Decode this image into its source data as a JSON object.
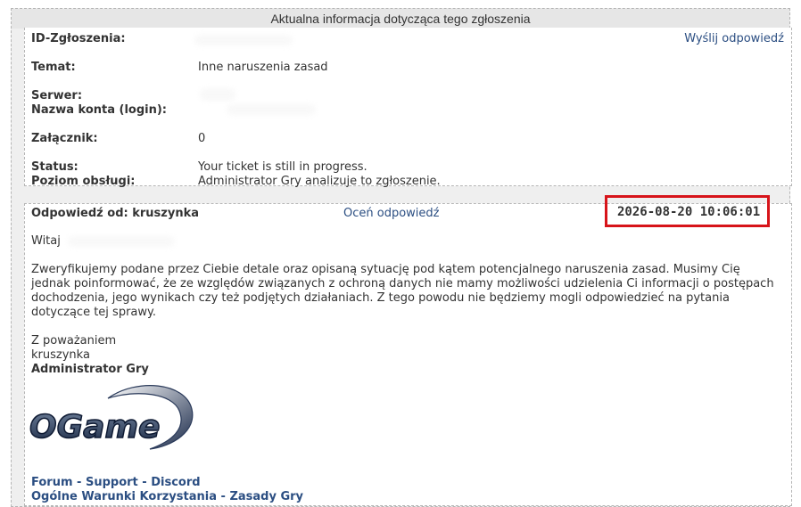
{
  "header": {
    "title": "Aktualna informacja dotycząca tego zgłoszenia"
  },
  "info": {
    "ticket_id_label": "ID-Zgłoszenia:",
    "send_reply_link": "Wyślij odpowiedź",
    "topic_label": "Temat:",
    "topic_value": "Inne naruszenia zasad",
    "server_label": "Serwer:",
    "account_label": "Nazwa konta (login):",
    "attachment_label": "Załącznik:",
    "attachment_value": "0",
    "status_label": "Status:",
    "status_value": "Your ticket is still in progress.",
    "service_level_label": "Poziom obsługi:",
    "service_level_value": "Administrator Gry analizuje to zgłoszenie."
  },
  "reply": {
    "from_label": "Odpowiedź od: kruszynka",
    "rate_link": "Oceń odpowiedź",
    "date": "2026-08-20 10:06:01",
    "greeting": "Witaj",
    "body": "Zweryfikujemy podane przez Ciebie detale oraz opisaną sytuację pod kątem potencjalnego naruszenia zasad. Musimy Cię jednak poinformować, że ze względów związanych z ochroną danych nie mamy możliwości udzielenia Ci informacji o postępach dochodzenia, jego wynikach czy też podjętych działaniach. Z tego powodu nie będziemy mogli odpowiedzieć na pytania dotyczące tej sprawy.",
    "regards": "Z poważaniem",
    "signature_name": "kruszynka",
    "signature_role": "Administrator Gry",
    "logo_text": "OGame"
  },
  "footer": {
    "forum": "Forum",
    "support": "Support",
    "discord": "Discord",
    "terms": "Ogólne Warunki Korzystania",
    "rules": "Zasady Gry",
    "sep": "-"
  },
  "colors": {
    "link": "#2b4e82",
    "highlight": "#d7141a"
  }
}
